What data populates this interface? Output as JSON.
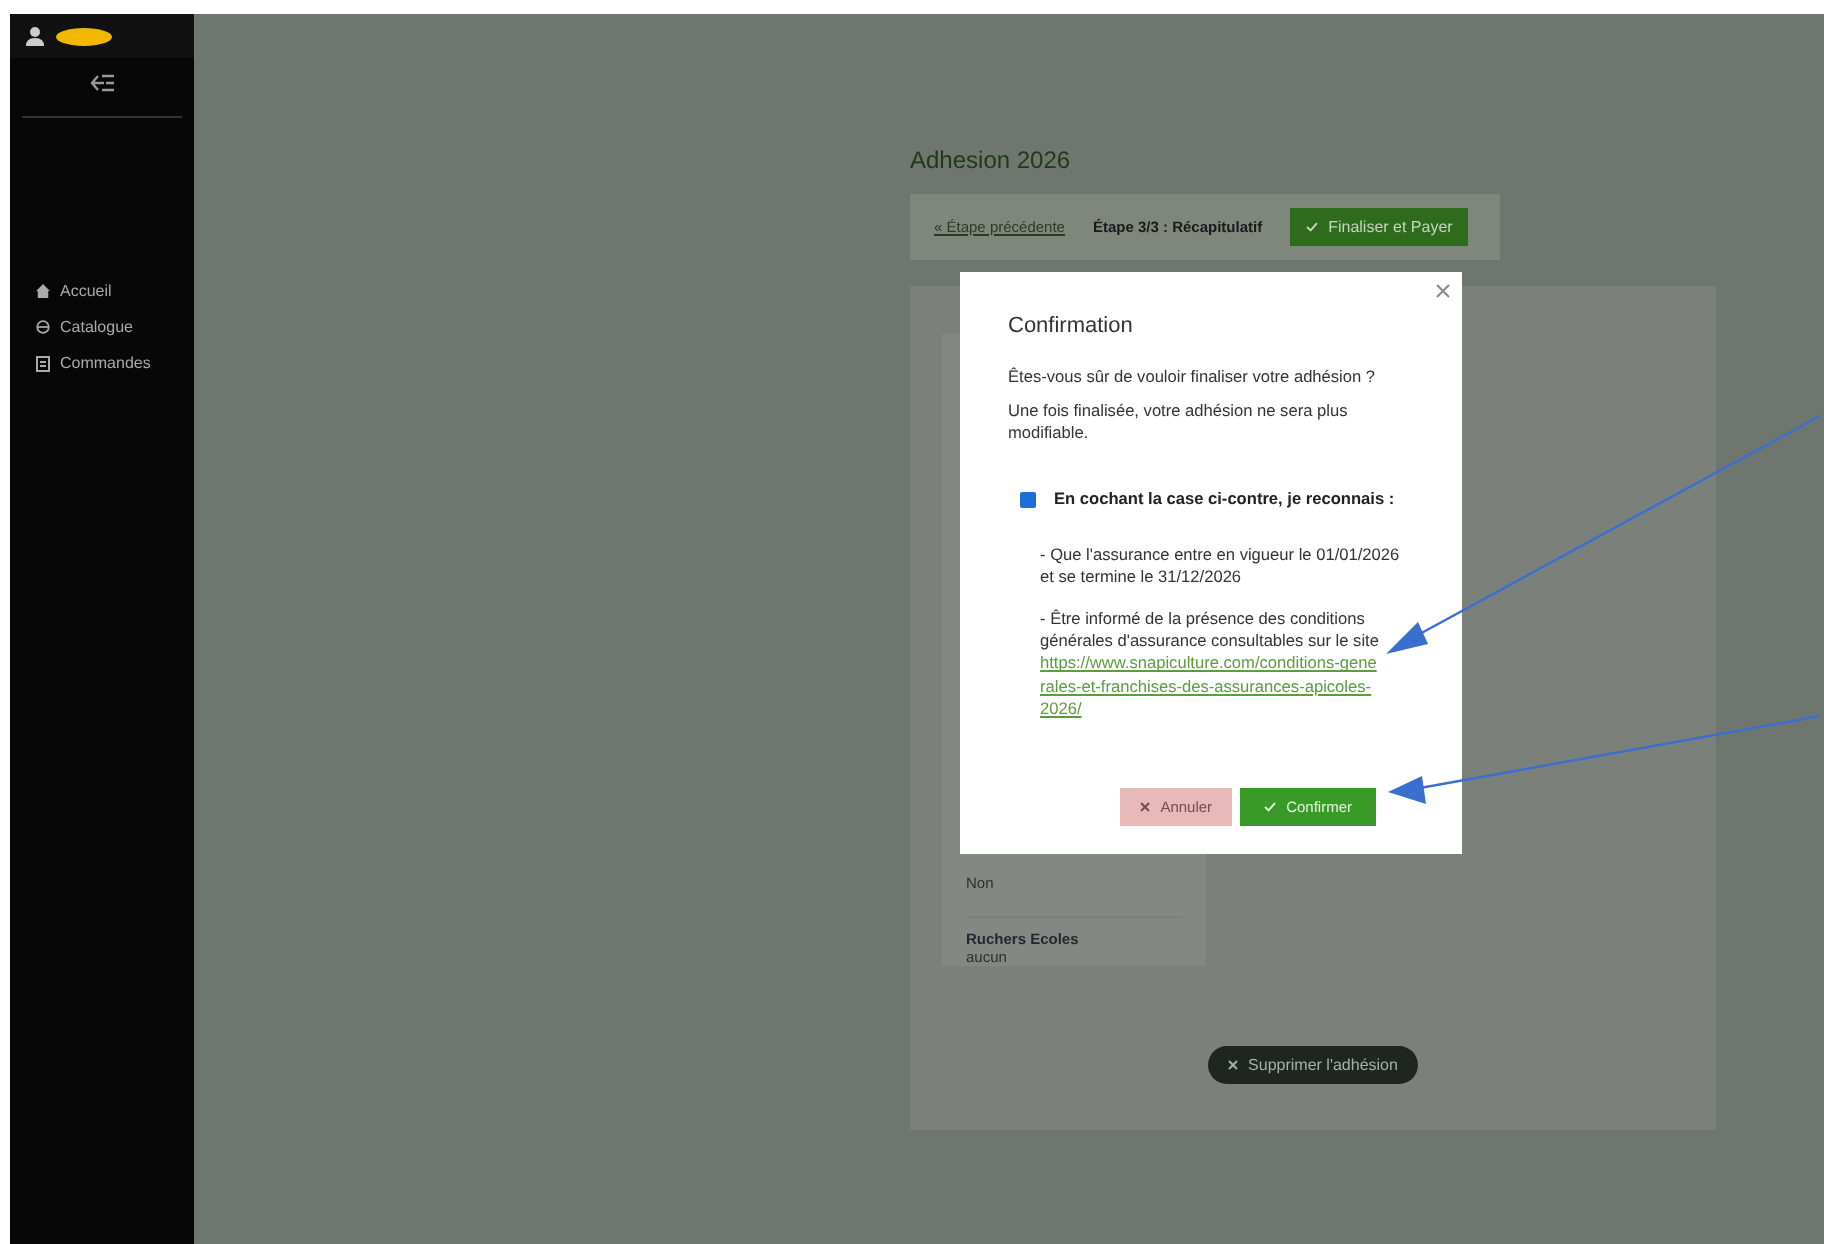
{
  "sidebar": {
    "items": [
      {
        "label": "Accueil"
      },
      {
        "label": "Catalogue"
      },
      {
        "label": "Commandes"
      }
    ]
  },
  "page": {
    "title": "Adhesion 2026",
    "steps": {
      "previous": "« Étape précédente",
      "current": "Étape 3/3 : Récapitulatif",
      "next": "Finaliser et Payer"
    },
    "fields": [
      {
        "label": "Ruchers Ecoles",
        "value": "aucun"
      }
    ],
    "orphan_value": "Non",
    "delete_button": "Supprimer l'adhésion"
  },
  "modal": {
    "title": "Confirmation",
    "question": "Êtes-vous sûr de vouloir finaliser votre adhésion ?",
    "warning": "Une fois finalisée, votre adhésion ne sera plus modifiable.",
    "checkbox": {
      "label": "En cochant la case ci-contre, je reconnais :",
      "checked": true
    },
    "point_1": "-  Que l'assurance entre en vigueur le 01/01/2026 et se termine le 31/12/2026",
    "point_2": "-  Être informé de la présence des conditions générales d'assurance consultables sur le site",
    "link": "https://www.snapiculture.com/conditions-generales-et-franchises-des-assurances-apicoles-2026/",
    "cancel": "Annuler",
    "confirm": "Confirmer"
  }
}
